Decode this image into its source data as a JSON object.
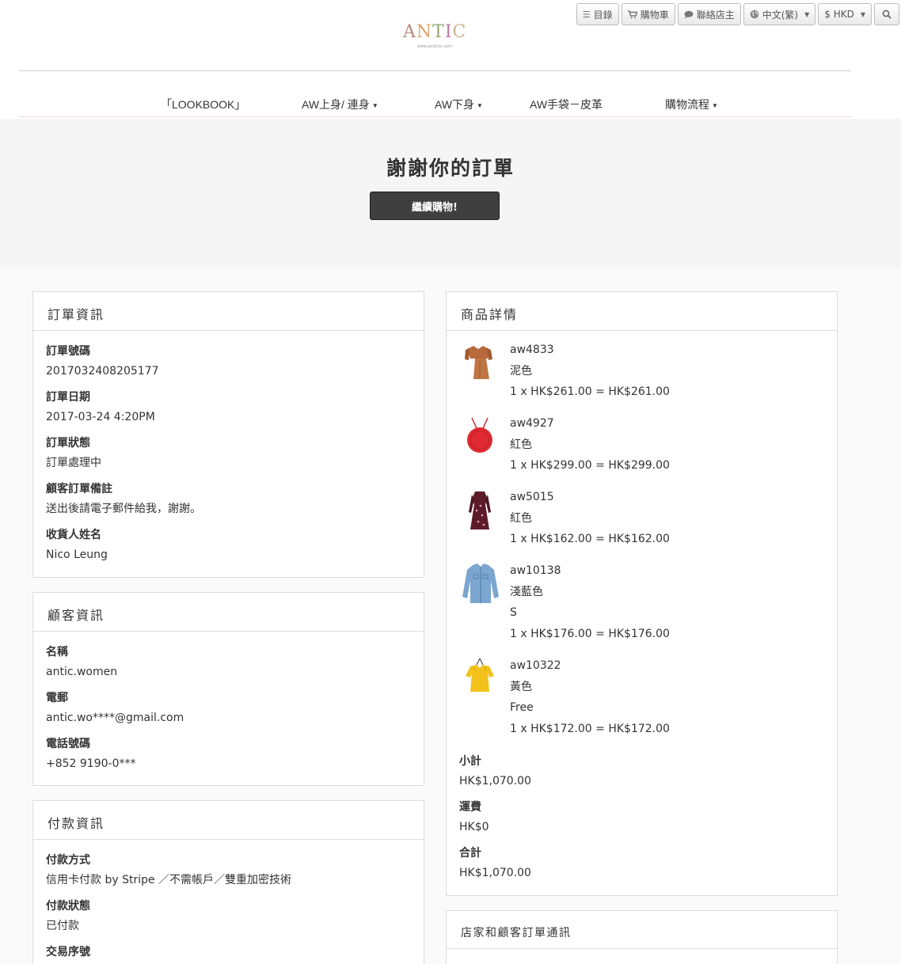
{
  "topbar": {
    "catalog": "目錄",
    "cart": "購物車",
    "contact": "聯絡店主",
    "language": "中文(繁)",
    "currency": "$ HKD"
  },
  "logo": {
    "word": "ANTIC",
    "subtitle": "www.antictic.com"
  },
  "nav": [
    {
      "label": "「LOOKBOOK」"
    },
    {
      "label": "AW上身/ 連身"
    },
    {
      "label": "AW下身"
    },
    {
      "label": "AW手袋－皮革"
    },
    {
      "label": "購物流程"
    }
  ],
  "hero": {
    "title": "謝謝你的訂單",
    "button": "繼續購物!"
  },
  "order_info": {
    "title": "訂單資訊",
    "fields": [
      {
        "label": "訂單號碼",
        "value": "2017032408205177"
      },
      {
        "label": "訂單日期",
        "value": "2017-03-24 4:20PM"
      },
      {
        "label": "訂單狀態",
        "value": "訂單處理中"
      },
      {
        "label": "顧客訂單備註",
        "value": "送出後請電子郵件給我，謝謝。"
      },
      {
        "label": "收貨人姓名",
        "value": "Nico Leung"
      }
    ]
  },
  "customer_info": {
    "title": "顧客資訊",
    "fields": [
      {
        "label": "名稱",
        "value": "antic.women"
      },
      {
        "label": "電郵",
        "value": "antic.wo****@gmail.com"
      },
      {
        "label": "電話號碼",
        "value": "+852 9190-0***"
      }
    ]
  },
  "payment_info": {
    "title": "付款資訊",
    "fields": [
      {
        "label": "付款方式",
        "value": "信用卡付款 by Stripe ／不需帳戶／雙重加密技術"
      },
      {
        "label": "付款狀態",
        "value": "已付款"
      },
      {
        "label": "交易序號",
        "value": ""
      }
    ]
  },
  "product_details": {
    "title": "商品詳情",
    "items": [
      {
        "sku": "aw4833",
        "color": "泥色",
        "size": "",
        "line": "1 x HK$261.00 = HK$261.00",
        "icon": "brown-outfit-thumbnail"
      },
      {
        "sku": "aw4927",
        "color": "紅色",
        "size": "",
        "line": "1 x HK$299.00 = HK$299.00",
        "icon": "red-round-bag-thumbnail"
      },
      {
        "sku": "aw5015",
        "color": "紅色",
        "size": "",
        "line": "1 x HK$162.00 = HK$162.00",
        "icon": "floral-dress-thumbnail"
      },
      {
        "sku": "aw10138",
        "color": "淺藍色",
        "size": "S",
        "line": "1 x HK$176.00 = HK$176.00",
        "icon": "denim-shirt-thumbnail"
      },
      {
        "sku": "aw10322",
        "color": "黃色",
        "size": "Free",
        "line": "1 x HK$172.00 = HK$172.00",
        "icon": "yellow-top-thumbnail"
      }
    ],
    "subtotal_label": "小計",
    "subtotal": "HK$1,070.00",
    "shipping_label": "運費",
    "shipping": "HK$0",
    "total_label": "合計",
    "total": "HK$1,070.00"
  },
  "messages": {
    "title": "店家和顧客訂單通訊"
  },
  "colors": {
    "hero_bg": "#f5f5f5",
    "button_bg": "#3f3f3f",
    "panel_border": "#dcdcdc",
    "nav_rule": "#f3d9dd"
  }
}
